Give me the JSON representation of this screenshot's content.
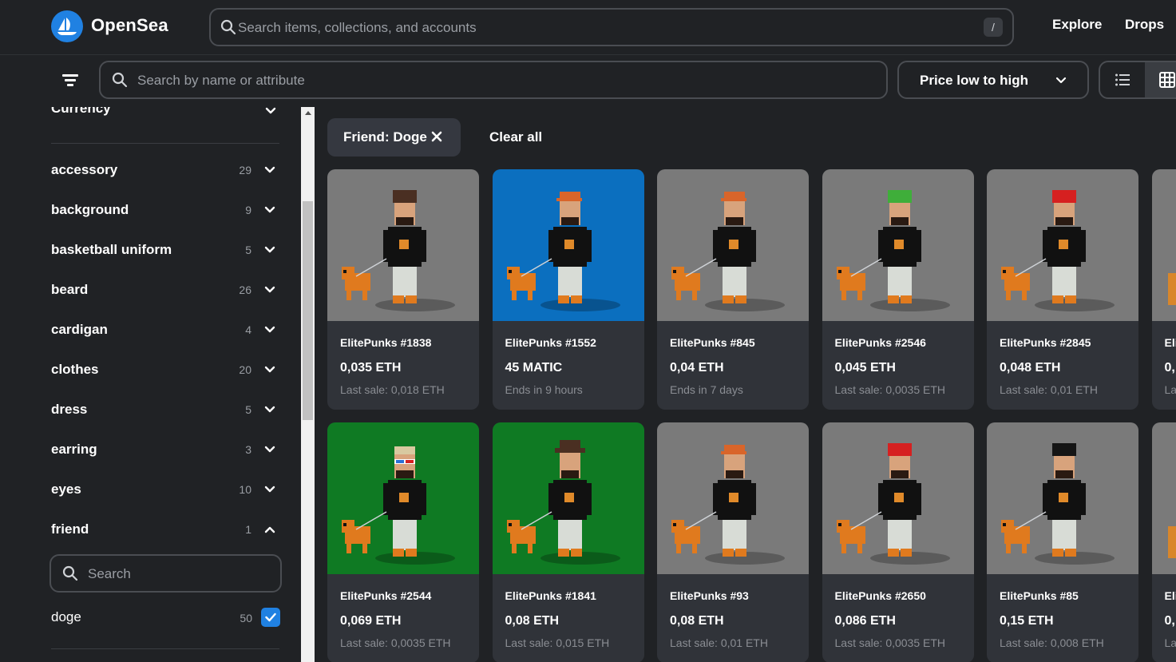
{
  "header": {
    "brand": "OpenSea",
    "search_placeholder": "Search items, collections, and accounts",
    "search_shortcut": "/",
    "nav": [
      "Explore",
      "Drops"
    ]
  },
  "toolbar": {
    "filter_search_placeholder": "Search by name or attribute",
    "sort_label": "Price low to high"
  },
  "sidebar": {
    "currency_label": "Currency",
    "attributes": [
      {
        "name": "accessory",
        "count": "29",
        "expanded": false
      },
      {
        "name": "background",
        "count": "9",
        "expanded": false
      },
      {
        "name": "basketball uniform",
        "count": "5",
        "expanded": false
      },
      {
        "name": "beard",
        "count": "26",
        "expanded": false
      },
      {
        "name": "cardigan",
        "count": "4",
        "expanded": false
      },
      {
        "name": "clothes",
        "count": "20",
        "expanded": false
      },
      {
        "name": "dress",
        "count": "5",
        "expanded": false
      },
      {
        "name": "earring",
        "count": "3",
        "expanded": false
      },
      {
        "name": "eyes",
        "count": "10",
        "expanded": false
      },
      {
        "name": "friend",
        "count": "1",
        "expanded": true
      }
    ],
    "friend_search_placeholder": "Search",
    "friend_options": [
      {
        "name": "doge",
        "count": "50",
        "checked": true
      }
    ]
  },
  "filters": {
    "active_chip": "Friend: Doge",
    "clear_all": "Clear all"
  },
  "items": [
    {
      "title": "ElitePunks #1838",
      "price": "0,035 ETH",
      "sub": "Last sale: 0,018 ETH",
      "bg": "#7a7a7a",
      "hair": "beard-brown",
      "hat": "#4a2f22"
    },
    {
      "title": "ElitePunks #1552",
      "price": "45 MATIC",
      "sub": "Ends in 9 hours",
      "bg": "#0b6fbf",
      "hair": "orange-cap",
      "hat": "#d9652a"
    },
    {
      "title": "ElitePunks #845",
      "price": "0,04 ETH",
      "sub": "Ends in 7 days",
      "bg": "#7a7a7a",
      "hair": "orange-cap",
      "hat": "#d9652a"
    },
    {
      "title": "ElitePunks #2546",
      "price": "0,045 ETH",
      "sub": "Last sale: 0,0035 ETH",
      "bg": "#7a7a7a",
      "hair": "green",
      "hat": "#3fae3a"
    },
    {
      "title": "ElitePunks #2845",
      "price": "0,048 ETH",
      "sub": "Last sale: 0,01 ETH",
      "bg": "#7a7a7a",
      "hair": "red",
      "hat": "#d62020"
    },
    {
      "title": "Eli",
      "price": "0,",
      "sub": "La",
      "bg": "#7a7a7a",
      "hair": "none",
      "hat": "#7a7a7a"
    },
    {
      "title": "ElitePunks #2544",
      "price": "0,069 ETH",
      "sub": "Last sale: 0,0035 ETH",
      "bg": "#0f7a23",
      "hair": "glasses",
      "hat": "#d8c9a0"
    },
    {
      "title": "ElitePunks #1841",
      "price": "0,08 ETH",
      "sub": "Last sale: 0,015 ETH",
      "bg": "#0f7a23",
      "hair": "hat-brown",
      "hat": "#4a2f22"
    },
    {
      "title": "ElitePunks #93",
      "price": "0,08 ETH",
      "sub": "Last sale: 0,01 ETH",
      "bg": "#7a7a7a",
      "hair": "orange-cap",
      "hat": "#d9652a"
    },
    {
      "title": "ElitePunks #2650",
      "price": "0,086 ETH",
      "sub": "Last sale: 0,0035 ETH",
      "bg": "#7a7a7a",
      "hair": "red",
      "hat": "#d62020"
    },
    {
      "title": "ElitePunks #85",
      "price": "0,15 ETH",
      "sub": "Last sale: 0,008 ETH",
      "bg": "#7a7a7a",
      "hair": "black",
      "hat": "#151515"
    },
    {
      "title": "Eli",
      "price": "0,",
      "sub": "La",
      "bg": "#7a7a7a",
      "hair": "none",
      "hat": "#7a7a7a"
    }
  ],
  "colors": {
    "accent": "#2081e2",
    "background": "#202225",
    "card": "#303339"
  }
}
